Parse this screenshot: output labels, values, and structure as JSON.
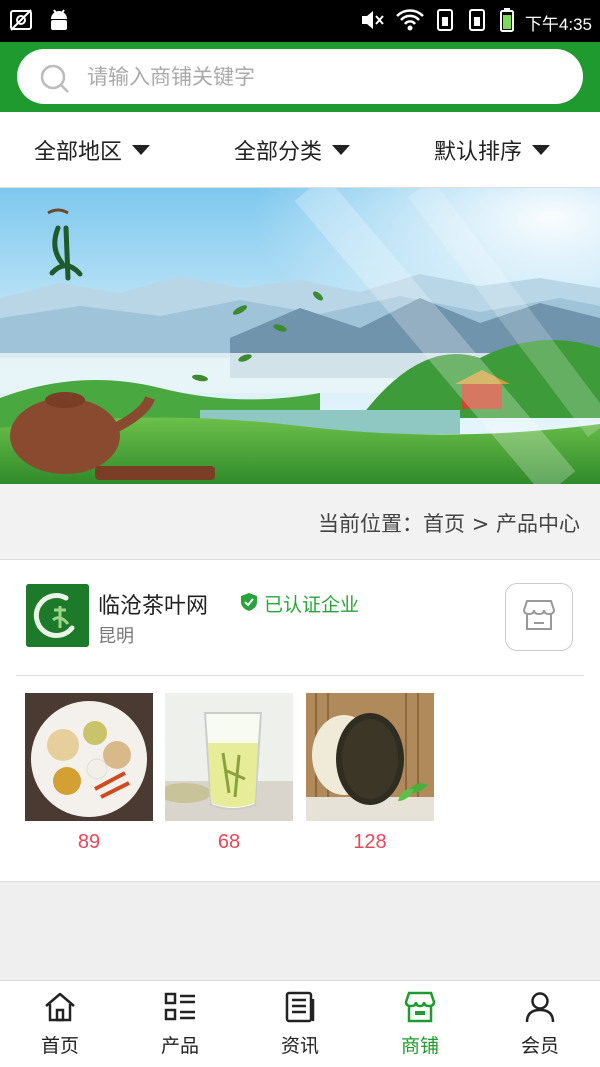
{
  "status_bar": {
    "time": "下午4:35"
  },
  "search": {
    "placeholder": "请输入商铺关键字"
  },
  "filters": [
    {
      "label": "全部地区"
    },
    {
      "label": "全部分类"
    },
    {
      "label": "默认排序"
    }
  ],
  "breadcrumb": {
    "text": "当前位置：首页 > 产品中心"
  },
  "store": {
    "name": "临沧茶叶网",
    "verified_label": "已认证企业",
    "city": "昆明",
    "products": [
      {
        "price": "89"
      },
      {
        "price": "68"
      },
      {
        "price": "128"
      }
    ]
  },
  "bottom_nav": [
    {
      "label": "首页",
      "icon": "home-icon"
    },
    {
      "label": "产品",
      "icon": "grid-list-icon"
    },
    {
      "label": "资讯",
      "icon": "news-icon"
    },
    {
      "label": "商铺",
      "icon": "shop-icon",
      "active": true
    },
    {
      "label": "会员",
      "icon": "user-icon"
    }
  ],
  "colors": {
    "brand_green": "#1e9a2e",
    "price_red": "#e8465a",
    "verified_green": "#2aa33c"
  }
}
